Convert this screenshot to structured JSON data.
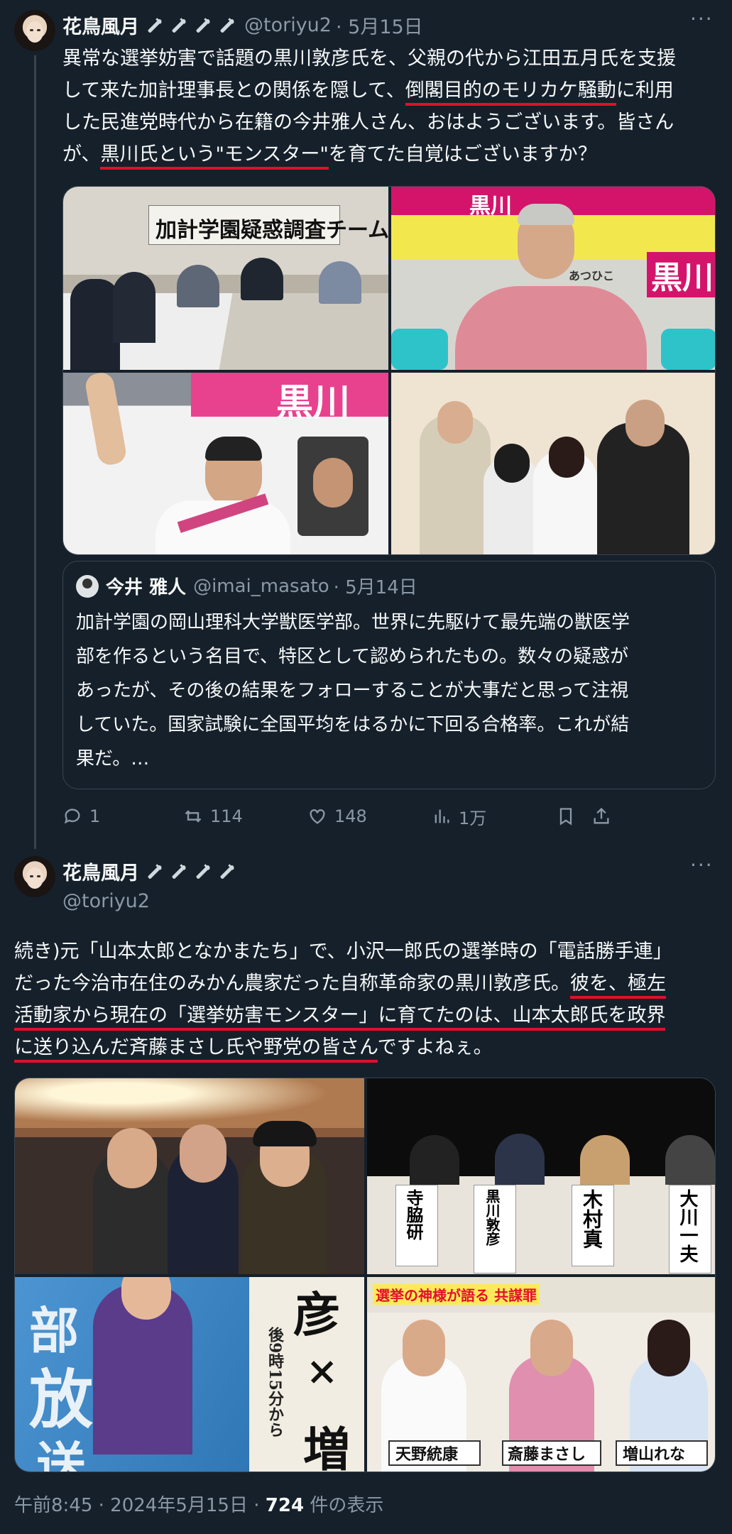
{
  "tweet1": {
    "display_name": "花鳥風月",
    "handle": "@toriyu2",
    "date": "· 5月15日",
    "more_label": "···",
    "text_parts": [
      "異常な選挙妨害で話題の黒川敦彦氏を、父親の代から江田五月氏を支援",
      "して来た加計理事長との関係を隠して、",
      "倒閣目的のモリカケ騒動",
      "に利用",
      "した民進党時代から在籍の今井雅人さん、おはようございます。皆さん",
      "が、",
      "黒川氏という\"モンスター\"",
      "を育てた自覚はございますか？"
    ],
    "images": {
      "a_banner": "加計学園疑惑調査チーム",
      "b_poster_name": "黒川",
      "b_poster_small": "あつひこ",
      "c_banner": "黒川"
    },
    "quote": {
      "display_name": "今井 雅人",
      "handle": "@imai_masato",
      "date": "· 5月14日",
      "lines": [
        "加計学園の岡山理科大学獣医学部。世界に先駆けて最先端の獣医学",
        "部を作るという名目で、特区として認められたもの。数々の疑惑が",
        "あったが、その後の結果をフォローすることが大事だと思って注視",
        "していた。国家試験に全国平均をはるかに下回る合格率。これが結",
        "果だ。…"
      ]
    },
    "actions": {
      "replies": "1",
      "retweets": "114",
      "likes": "148",
      "views": "1万"
    }
  },
  "tweet2": {
    "display_name": "花鳥風月",
    "handle": "@toriyu2",
    "more_label": "···",
    "line1": "続き)元「山本太郎となかまたち」で、小沢一郎氏の選挙時の「電話勝手連」",
    "line2": "だった今治市在住のみかん農家だった自称革命家の黒川敦彦氏。",
    "line2_ul": "彼を、極左",
    "line3_ul": "活動家から現在の「選挙妨害モンスター」に育てたのは、山本太郎氏を政界",
    "line4_ul": "に送り込んだ斉藤まさし氏や野党の皆さん",
    "line4_rest": "ですよねぇ。",
    "images": {
      "b_names": [
        "寺脇研",
        "黒川敦彦",
        "木村真",
        "大川一夫"
      ],
      "c_text": [
        "部",
        "放",
        "送"
      ],
      "c_text2": [
        "彦",
        "×",
        "増"
      ],
      "c_time": "後9時15分から",
      "d_top": "選挙の神様が語る 共謀罪",
      "d_names": [
        "天野統康",
        "斎藤まさし",
        "増山れな"
      ]
    },
    "timestamp": "午前8:45 · 2024年5月15日 · ",
    "views_count": "724",
    "views_suffix": " 件の表示"
  },
  "colors": {
    "background": "#15202b",
    "text": "#f7f9f9",
    "muted": "#8b98a5",
    "border": "#38444d",
    "underline": "#e0102a"
  }
}
